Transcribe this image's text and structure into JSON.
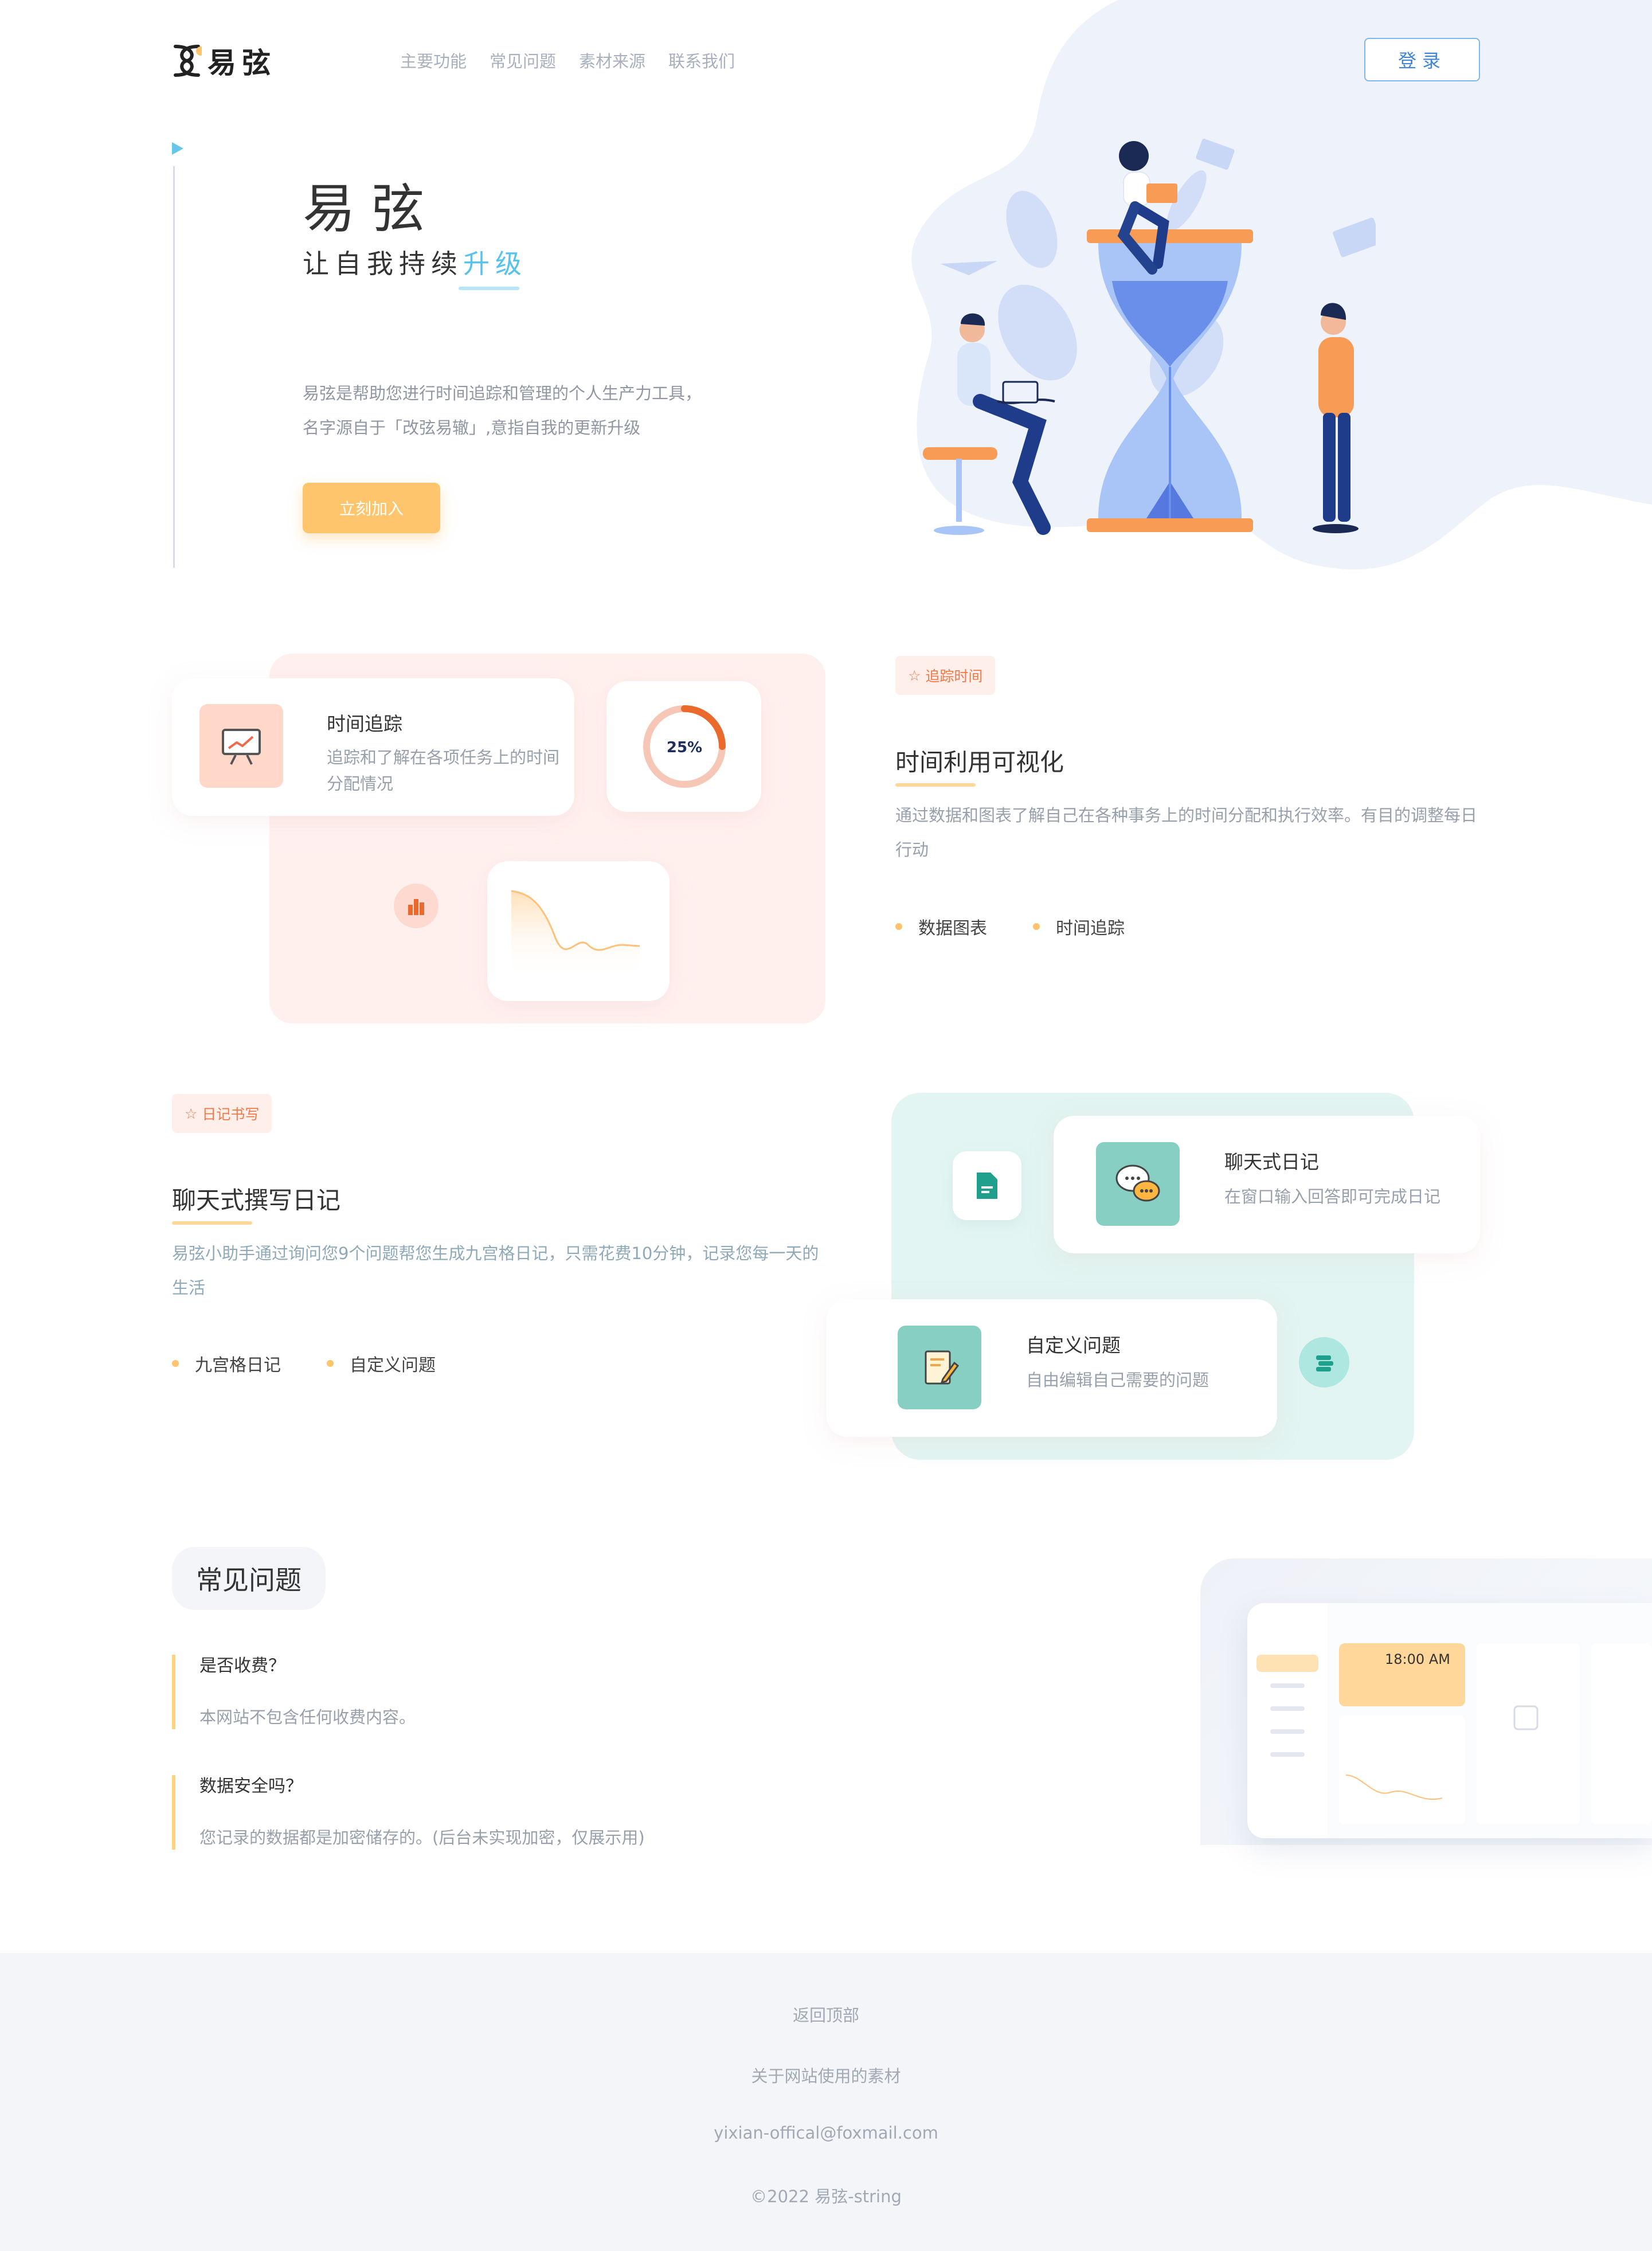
{
  "brand": {
    "logo_text": "易弦"
  },
  "nav": {
    "items": [
      "主要功能",
      "常见问题",
      "素材来源",
      "联系我们"
    ],
    "login": "登录"
  },
  "hero": {
    "title": "易弦",
    "subtitle_prefix": "让自我持续",
    "subtitle_highlight": "升级",
    "desc_line1": "易弦是帮助您进行时间追踪和管理的个人生产力工具，",
    "desc_line2": "名字源自于「改弦易辙」,意指自我的更新升级",
    "cta": "立刻加入"
  },
  "feature_time": {
    "tag": "追踪时间",
    "title": "时间利用可视化",
    "desc": "通过数据和图表了解自己在各种事务上的时间分配和执行效率。有目的调整每日行动",
    "bullets": [
      "数据图表",
      "时间追踪"
    ],
    "card_title": "时间追踪",
    "card_desc": "追踪和了解在各项任务上的时间分配情况",
    "ring_label": "25%",
    "ring_progress": 0.25
  },
  "feature_diary": {
    "tag": "日记书写",
    "title": "聊天式撰写日记",
    "desc": "易弦小助手通过询问您9个问题帮您生成九宫格日记，只需花费10分钟，记录您每一天的生活",
    "bullets": [
      "九宫格日记",
      "自定义问题"
    ],
    "card1_title": "聊天式日记",
    "card1_desc": "在窗口输入回答即可完成日记",
    "card2_title": "自定义问题",
    "card2_desc": "自由编辑自己需要的问题"
  },
  "faq": {
    "title": "常见问题",
    "items": [
      {
        "q": "是否收费？",
        "a": "本网站不包含任何收费内容。"
      },
      {
        "q": "数据安全吗？",
        "a": "您记录的数据都是加密储存的。(后台未实现加密，仅展示用)"
      }
    ]
  },
  "preview": {
    "time": "18:00 AM"
  },
  "footer": {
    "back_top": "返回顶部",
    "about": "关于网站使用的素材",
    "email": "yixian-offical@foxmail.com",
    "copyright": "©2022 易弦-string"
  },
  "colors": {
    "accent_blue": "#56c3ea",
    "cta_orange": "#ffc56d",
    "tag_orange": "#f07a4a",
    "teal": "#86cfc2"
  }
}
